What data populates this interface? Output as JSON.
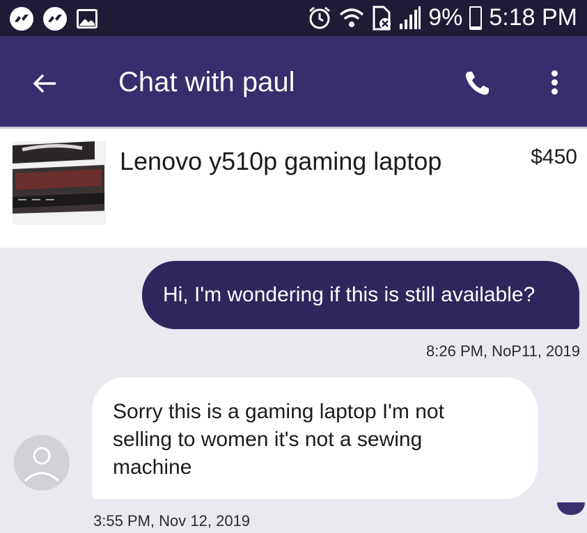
{
  "status_bar": {
    "battery_percent": "9%",
    "time": "5:18 PM",
    "battery_level": 0.09
  },
  "header": {
    "title": "Chat with paul"
  },
  "listing": {
    "title": "Lenovo y510p gaming laptop",
    "price": "$450"
  },
  "messages": [
    {
      "direction": "outgoing",
      "text": "Hi, I'm wondering if this is still available?",
      "timestamp": "8:26 PM, NoP11, 2019"
    },
    {
      "direction": "incoming",
      "lines": [
        "Sorry this is a gaming laptop I'm not",
        "selling to women it's not a sewing",
        "machine"
      ],
      "timestamp": "3:55 PM, Nov 12, 2019"
    }
  ],
  "colors": {
    "status_bar": "#1f1a36",
    "header": "#3a2d6e",
    "outgoing_bubble": "#2f275c",
    "background": "#ebe9f0"
  }
}
